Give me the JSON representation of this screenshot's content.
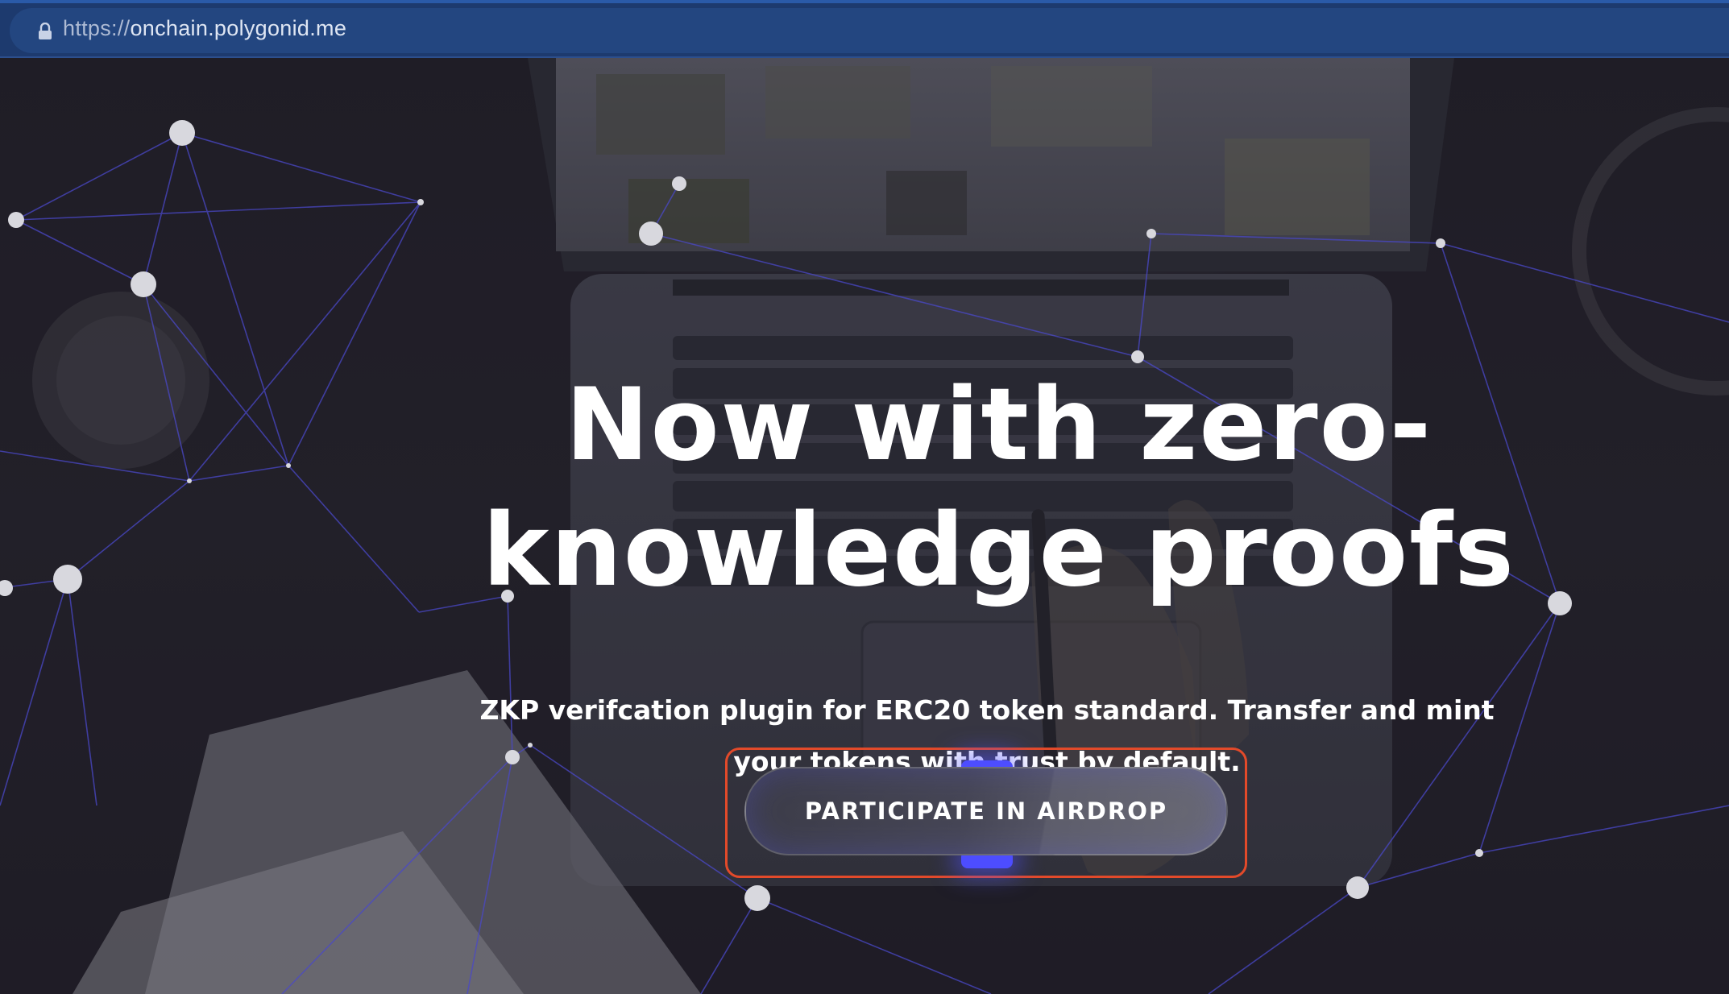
{
  "browser": {
    "url_scheme": "https://",
    "url_host": "onchain.polygonid.me",
    "icons": {
      "lock": "lock-icon"
    }
  },
  "hero": {
    "headline_line1": "Now with zero-",
    "headline_line2": "knowledge proofs",
    "subhead": "ZKP verifcation plugin for ERC20 token standard. Transfer and mint your tokens with trust by default.",
    "cta_label": "PARTICIPATE IN AIRDROP"
  },
  "colors": {
    "address_bar": "#1d3a6e",
    "network_lines": "#4a48c8",
    "cta_highlight": "#e34a2a",
    "cta_glow": "#4d4dff"
  }
}
